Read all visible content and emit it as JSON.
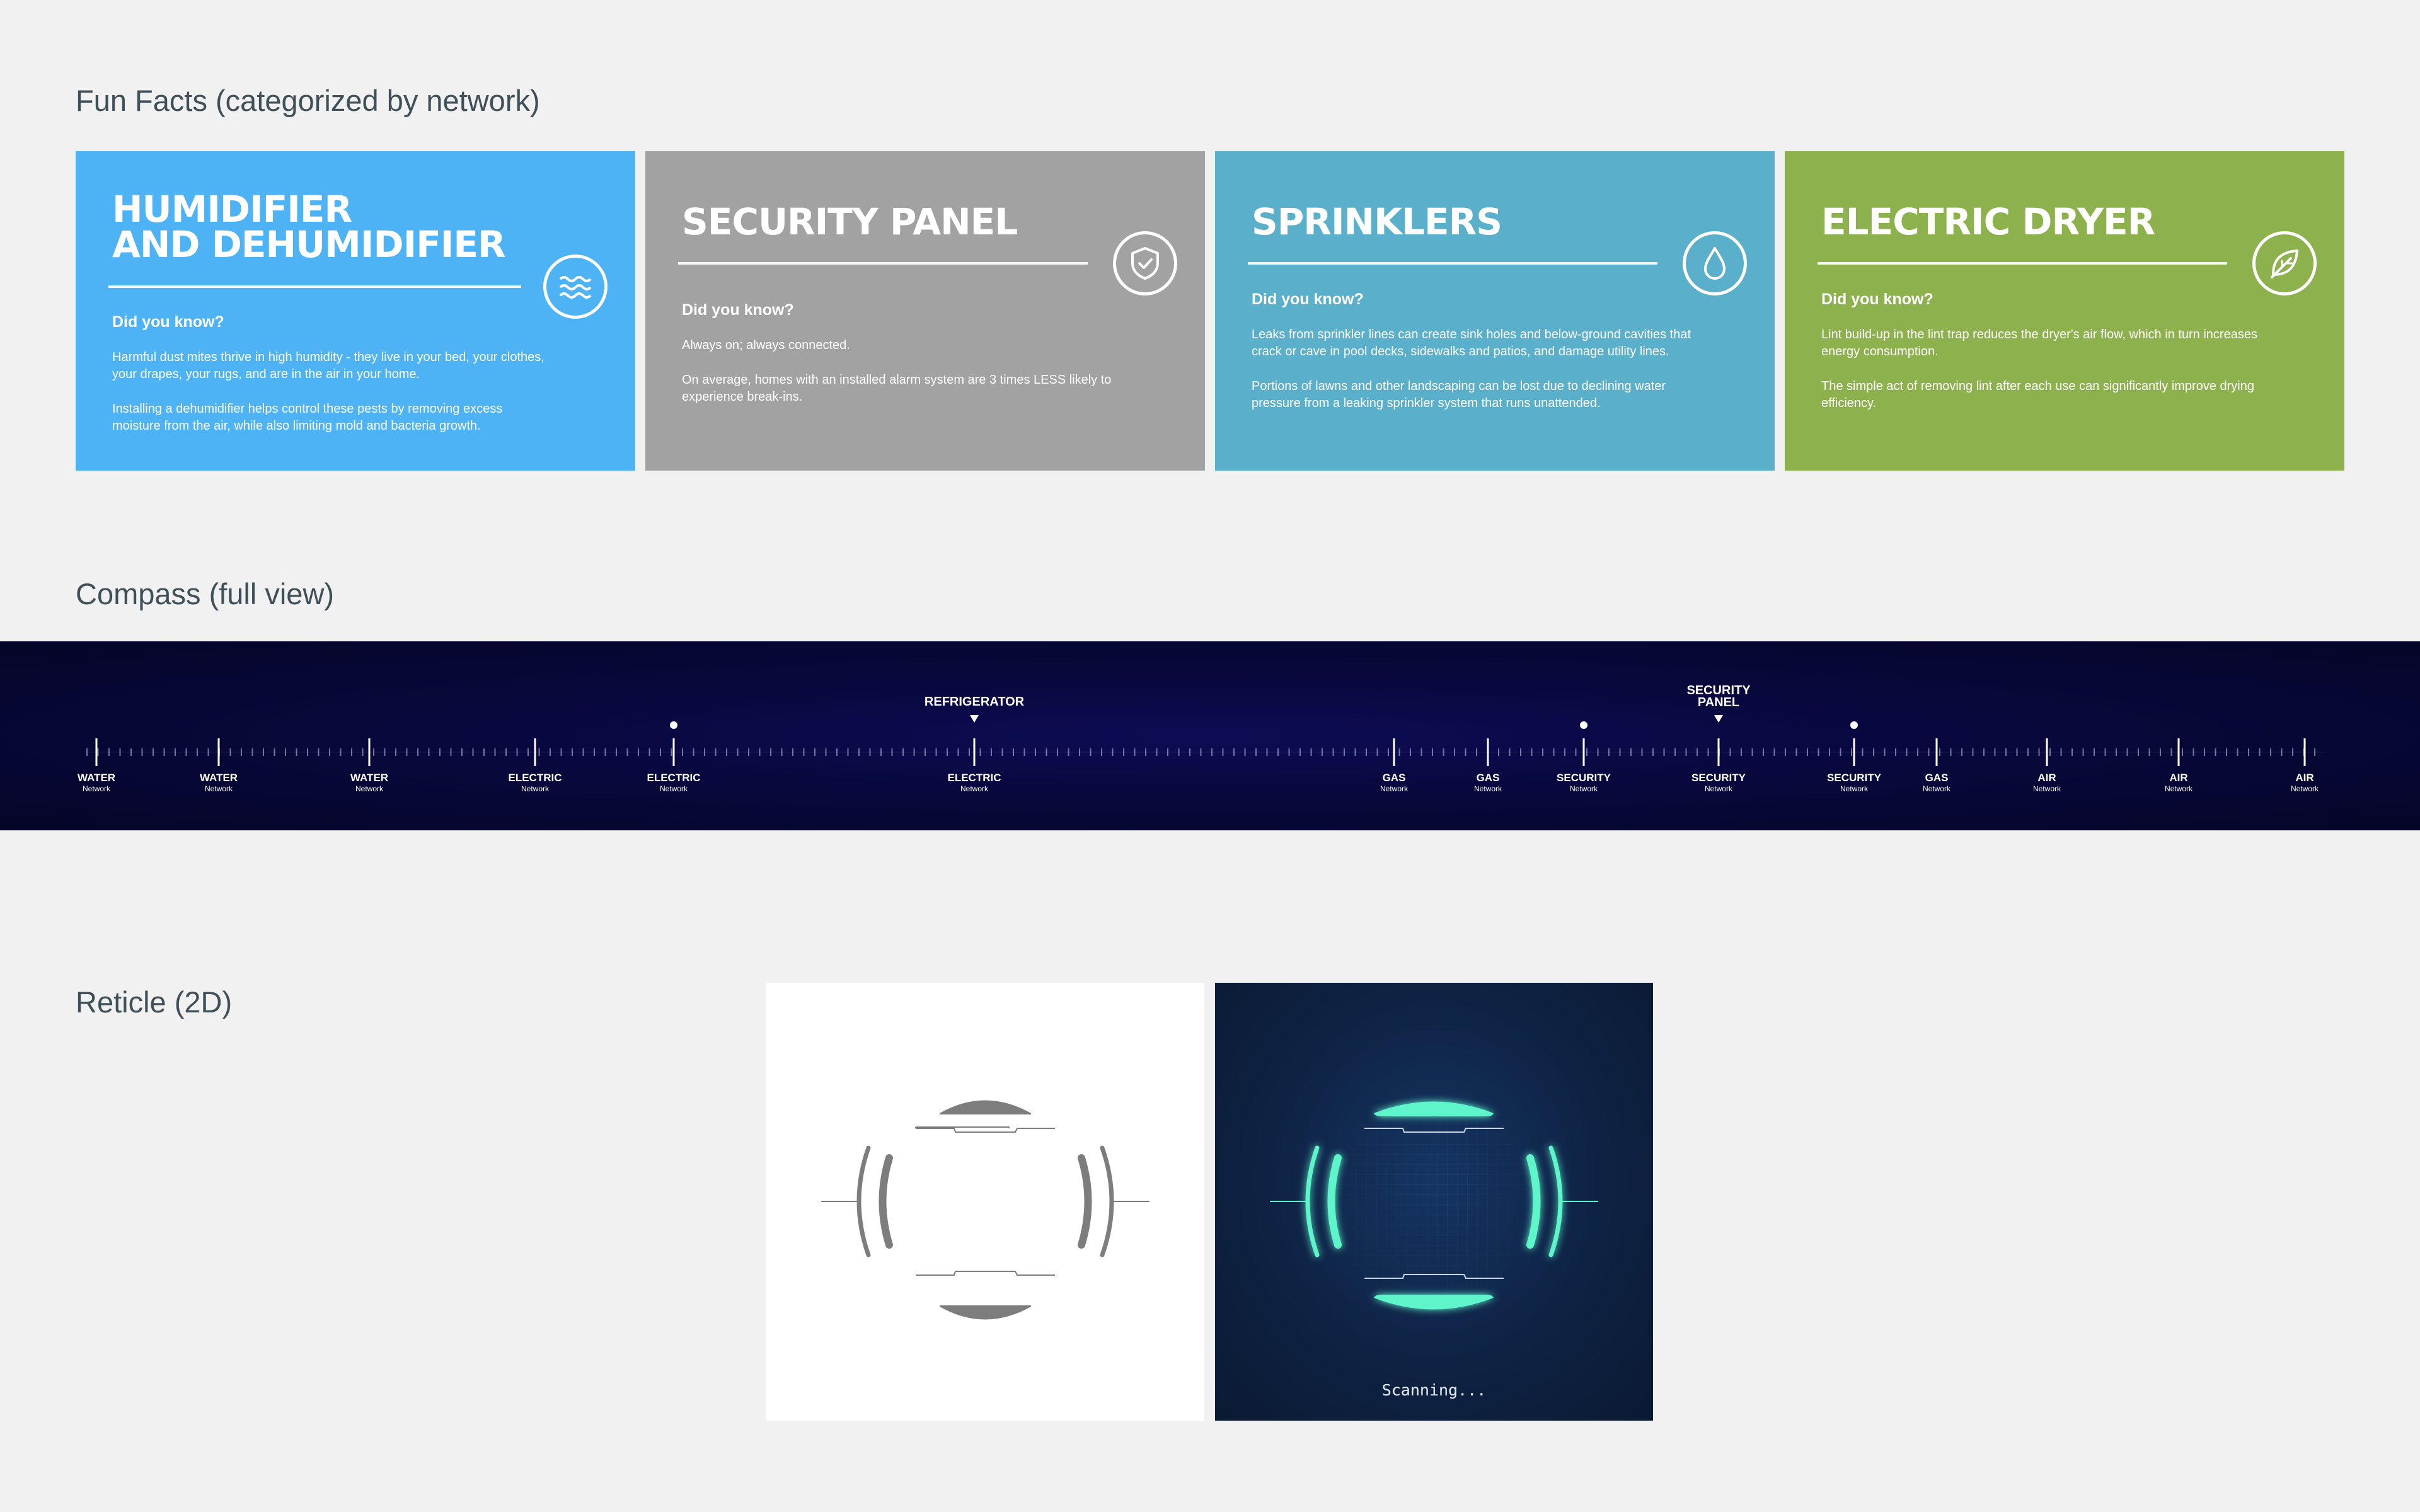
{
  "sections": {
    "fun_facts": "Fun Facts (categorized by network)",
    "compass": "Compass (full view)",
    "reticle": "Reticle (2D)"
  },
  "cards": [
    {
      "title_line1": "HUMIDIFIER",
      "title_line2": "AND DEHUMIDIFIER",
      "question": "Did you know?",
      "p1": "Harmful dust mites thrive in high humidity - they live in your bed, your clothes, your drapes, your rugs, and are in the air in your home.",
      "p2": "Installing a dehumidifier helps control these pests by removing excess moisture from the air, while also limiting mold and bacteria growth.",
      "color": "#4db3f4",
      "icon": "waves-icon"
    },
    {
      "title_line1": "SECURITY PANEL",
      "question": "Did you know?",
      "p1": "Always on; always connected.",
      "p2": "On average, homes with an installed alarm system are 3 times LESS likely to experience break-ins.",
      "color": "#a2a2a2",
      "icon": "shield-check-icon"
    },
    {
      "title_line1": "SPRINKLERS",
      "question": "Did you know?",
      "p1": "Leaks from sprinkler lines can create sink holes and below-ground cavities that crack or cave in pool decks, sidewalks and patios, and damage utility lines.",
      "p2": "Portions of lawns and other landscaping can be lost due to declining water pressure from a leaking sprinkler system that runs unattended.",
      "color": "#5aafca",
      "icon": "water-drop-icon"
    },
    {
      "title_line1": "ELECTRIC DRYER",
      "question": "Did you know?",
      "p1": "Lint build-up in the lint trap reduces the dryer's air flow, which in turn increases energy consumption.",
      "p2": "The simple act of removing lint after each use can significantly improve drying efficiency.",
      "color": "#8db14c",
      "icon": "leaf-icon"
    }
  ],
  "compass": {
    "network_word": "Network",
    "markers": [
      {
        "label": "WATER"
      },
      {
        "label": "WATER"
      },
      {
        "label": "WATER"
      },
      {
        "label": "ELECTRIC"
      },
      {
        "label": "ELECTRIC",
        "dot": true
      },
      {
        "label": "ELECTRIC",
        "device": "REFRIGERATOR"
      },
      {
        "label": "GAS"
      },
      {
        "label": "GAS"
      },
      {
        "label": "SECURITY",
        "dot": true
      },
      {
        "label": "SECURITY",
        "device_l1": "SECURITY",
        "device_l2": "PANEL"
      },
      {
        "label": "SECURITY",
        "dot": true
      },
      {
        "label": "GAS"
      },
      {
        "label": "AIR"
      },
      {
        "label": "AIR"
      },
      {
        "label": "AIR"
      }
    ]
  },
  "reticle": {
    "scanning_text": "Scanning...",
    "active_color": "#5ef5cb",
    "inactive_color": "#7d7d7d"
  }
}
